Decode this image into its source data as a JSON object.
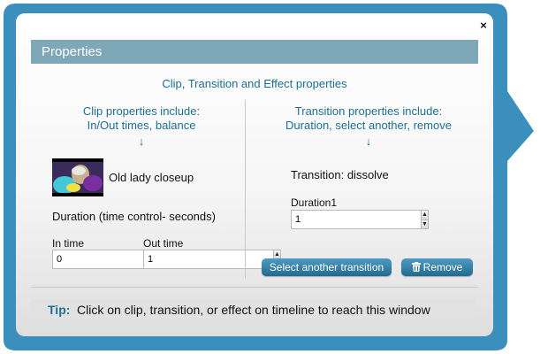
{
  "window": {
    "title": "Properties",
    "close_glyph": "×",
    "subtitle": "Clip, Transition and Effect properties",
    "accent_color": "#3a8fbd",
    "header_color": "#7ea8b8"
  },
  "clip": {
    "heading_line1": "Clip properties include:",
    "heading_line2": "In/Out times, balance",
    "arrow": "↓",
    "name": "Old lady closeup",
    "duration_label": "Duration (time control- seconds)",
    "in_label": "In time",
    "in_value": "0",
    "out_label": "Out time",
    "out_value": "1"
  },
  "transition": {
    "heading_line1": "Transition properties include:",
    "heading_line2": "Duration, select another, remove",
    "arrow": "↓",
    "current": "Transition: dissolve",
    "duration_label": "Duration1",
    "duration_value": "1",
    "select_button": "Select another transition",
    "remove_button": "Remove",
    "remove_icon": "trash-icon"
  },
  "spinner": {
    "up": "▲",
    "down": "▼"
  },
  "tip": {
    "label": "Tip:",
    "text": "Click on clip, transition, or effect on timeline to reach this window"
  }
}
